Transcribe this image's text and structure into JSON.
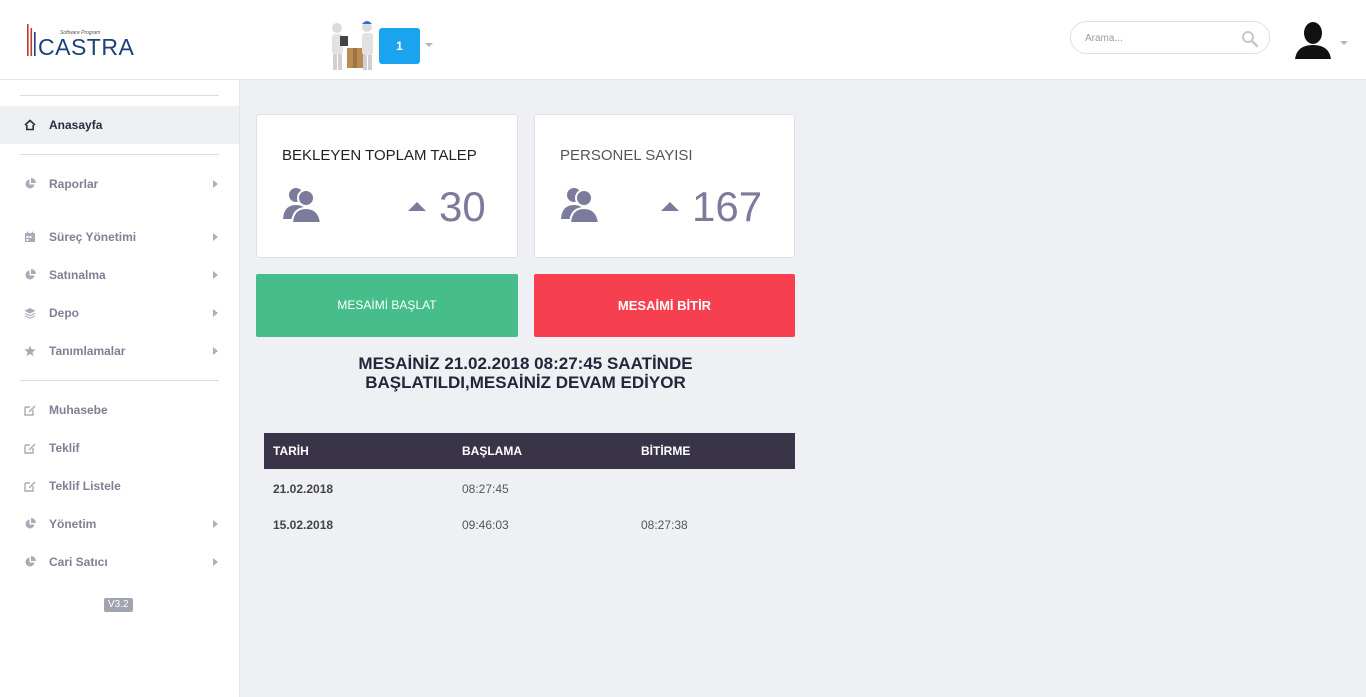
{
  "brand": {
    "tagline": "Software Program",
    "name": "CASTRA"
  },
  "header": {
    "company_button": "1",
    "search_placeholder": "Arama..."
  },
  "sidebar": {
    "items": [
      {
        "label": "Anasayfa",
        "icon": "home-icon",
        "active": true
      },
      {
        "label": "Raporlar",
        "icon": "pie-chart-icon",
        "arrow": true
      },
      {
        "label": "Süreç Yönetimi",
        "icon": "calendar-icon",
        "arrow": true
      },
      {
        "label": "Satınalma",
        "icon": "pie-chart-icon",
        "arrow": true
      },
      {
        "label": "Depo",
        "icon": "layers-icon",
        "arrow": true
      },
      {
        "label": "Tanımlamalar",
        "icon": "star-icon",
        "arrow": true
      },
      {
        "label": "Muhasebe",
        "icon": "edit-icon"
      },
      {
        "label": "Teklif",
        "icon": "edit-icon"
      },
      {
        "label": "Teklif Listele",
        "icon": "edit-icon"
      },
      {
        "label": "Yönetim",
        "icon": "pie-chart-icon",
        "arrow": true
      },
      {
        "label": "Cari Satıcı",
        "icon": "pie-chart-icon",
        "arrow": true
      }
    ],
    "version": "V3.2"
  },
  "cards": [
    {
      "title": "BEKLEYEN TOPLAM TALEP",
      "value": "30",
      "icon": "users-icon",
      "trend": "up"
    },
    {
      "title": "PERSONEL SAYISI",
      "value": "167",
      "icon": "users-icon",
      "trend": "up"
    }
  ],
  "buttons": {
    "start": "MESAİMİ BAŞLAT",
    "end": "MESAİMİ BİTİR"
  },
  "message": {
    "line1": "MESAİNİZ 21.02.2018 08:27:45 SAATİNDE",
    "line2": "BAŞLATILDI,MESAİNİZ DEVAM EDİYOR"
  },
  "table": {
    "headers": [
      "TARİH",
      "BAŞLAMA",
      "BİTİRME"
    ],
    "rows": [
      [
        "21.02.2018",
        "08:27:45",
        ""
      ],
      [
        "15.02.2018",
        "09:46:03",
        "08:27:38"
      ]
    ]
  },
  "colors": {
    "accent_blue": "#1aa3ef",
    "start_green": "#46bd8a",
    "end_red": "#f6404f",
    "table_header": "#3a3448",
    "stat_purple": "#7d7b9b"
  }
}
